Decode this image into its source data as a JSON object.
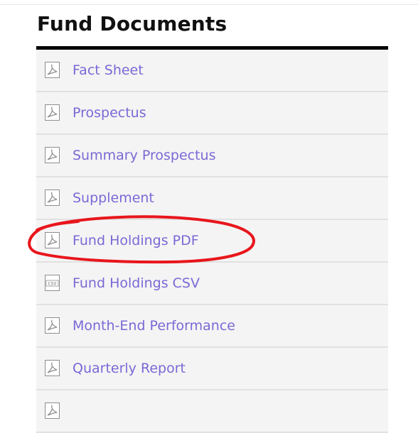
{
  "panel": {
    "title": "Fund Documents"
  },
  "documents": [
    {
      "label": "Fact Sheet",
      "icon": "pdf-icon"
    },
    {
      "label": "Prospectus",
      "icon": "pdf-icon"
    },
    {
      "label": "Summary Prospectus",
      "icon": "pdf-icon"
    },
    {
      "label": "Supplement",
      "icon": "pdf-icon"
    },
    {
      "label": "Fund Holdings PDF",
      "icon": "pdf-icon"
    },
    {
      "label": "Fund Holdings CSV",
      "icon": "csv-icon",
      "icon_text": "CSV"
    },
    {
      "label": "Month-End Performance",
      "icon": "pdf-icon"
    },
    {
      "label": "Quarterly Report",
      "icon": "pdf-icon"
    },
    {
      "label": "",
      "icon": "pdf-icon"
    }
  ],
  "colors": {
    "link": "#7b68d6",
    "row_background": "#f4f4f4",
    "row_divider": "#e1e1e1",
    "annotation": "#e8161c"
  },
  "annotation": {
    "shape": "hand-drawn-ellipse",
    "highlights": "Fund Holdings PDF"
  }
}
